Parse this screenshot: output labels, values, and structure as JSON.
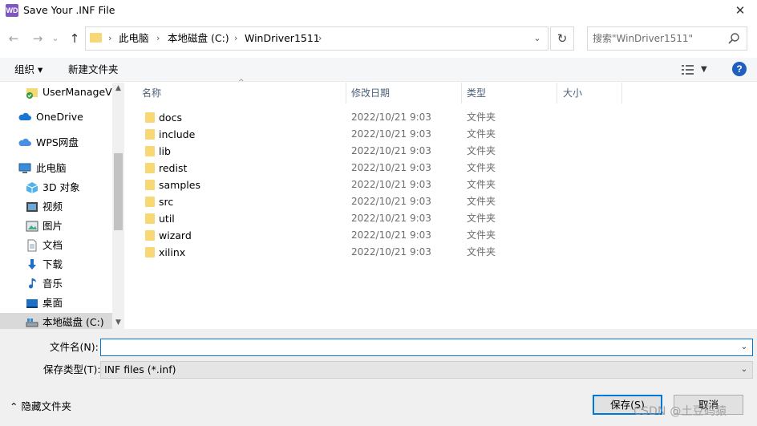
{
  "window": {
    "title": "Save Your .INF File",
    "app_icon_text": "WD",
    "close_glyph": "✕"
  },
  "nav": {
    "back_glyph": "←",
    "forward_glyph": "→",
    "history_glyph": "⌄",
    "up_glyph": "↑",
    "breadcrumbs": [
      "此电脑",
      "本地磁盘 (C:)",
      "WinDriver1511"
    ],
    "separator": "›",
    "dropdown_glyph": "⌄",
    "refresh_glyph": "↻",
    "search_placeholder": "搜索\"WinDriver1511\""
  },
  "toolbar": {
    "organize_label": "组织 ▾",
    "new_folder_label": "新建文件夹",
    "view_dropdown_glyph": "▼",
    "help_glyph": "?"
  },
  "sidebar": {
    "items": [
      {
        "label": "UserManageVi",
        "icon": "folder-check-icon"
      },
      {
        "label": "OneDrive",
        "icon": "cloud-icon"
      },
      {
        "label": "WPS网盘",
        "icon": "cloud-icon"
      },
      {
        "label": "此电脑",
        "icon": "computer-icon"
      },
      {
        "label": "3D 对象",
        "icon": "cube-icon"
      },
      {
        "label": "视频",
        "icon": "video-icon"
      },
      {
        "label": "图片",
        "icon": "picture-icon"
      },
      {
        "label": "文档",
        "icon": "document-icon"
      },
      {
        "label": "下载",
        "icon": "download-icon"
      },
      {
        "label": "音乐",
        "icon": "music-icon"
      },
      {
        "label": "桌面",
        "icon": "desktop-icon"
      },
      {
        "label": "本地磁盘 (C:)",
        "icon": "drive-icon"
      }
    ],
    "scroll_up_glyph": "▲",
    "scroll_down_glyph": "▼"
  },
  "file_list": {
    "columns": [
      "名称",
      "修改日期",
      "类型",
      "大小"
    ],
    "sort_glyph": "^",
    "rows": [
      {
        "name": "docs",
        "date": "2022/10/21 9:03",
        "type": "文件夹"
      },
      {
        "name": "include",
        "date": "2022/10/21 9:03",
        "type": "文件夹"
      },
      {
        "name": "lib",
        "date": "2022/10/21 9:03",
        "type": "文件夹"
      },
      {
        "name": "redist",
        "date": "2022/10/21 9:03",
        "type": "文件夹"
      },
      {
        "name": "samples",
        "date": "2022/10/21 9:03",
        "type": "文件夹"
      },
      {
        "name": "src",
        "date": "2022/10/21 9:03",
        "type": "文件夹"
      },
      {
        "name": "util",
        "date": "2022/10/21 9:03",
        "type": "文件夹"
      },
      {
        "name": "wizard",
        "date": "2022/10/21 9:03",
        "type": "文件夹"
      },
      {
        "name": "xilinx",
        "date": "2022/10/21 9:03",
        "type": "文件夹"
      }
    ]
  },
  "form": {
    "filename_label": "文件名(N):",
    "filename_value": "",
    "filetype_label": "保存类型(T):",
    "filetype_value": "INF files (*.inf)",
    "dropdown_glyph": "⌄",
    "hide_folders_label": "⌃  隐藏文件夹",
    "save_label": "保存(S)",
    "cancel_label": "取消"
  },
  "watermark": "CSDN @土豆码猿",
  "colors": {
    "accent": "#0078d7",
    "folder": "#f8d775",
    "selected_nav": "#d9d9d9",
    "header_text": "#4c607a"
  }
}
